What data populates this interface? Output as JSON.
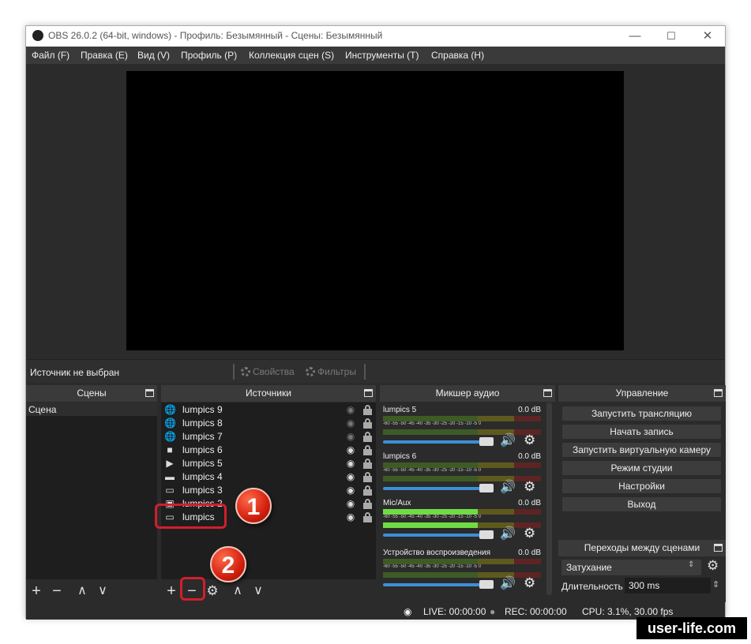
{
  "window": {
    "title": "OBS 26.0.2 (64-bit, windows) - Профиль: Безымянный - Сцены: Безымянный",
    "minimize": "—",
    "maximize": "☐",
    "close": "✕"
  },
  "menu": [
    "Файл (F)",
    "Правка (E)",
    "Вид (V)",
    "Профиль (P)",
    "Коллекция сцен (S)",
    "Инструменты (T)",
    "Справка (H)"
  ],
  "source_bar": {
    "label": "Источник не выбран",
    "properties": "Свойства",
    "filters": "Фильтры"
  },
  "scenes": {
    "title": "Сцены",
    "items": [
      "Сцена"
    ]
  },
  "sources": {
    "title": "Источники",
    "items": [
      {
        "name": "lumpics 9",
        "icon": "globe-icon",
        "visible": false
      },
      {
        "name": "lumpics 8",
        "icon": "globe-icon",
        "visible": false
      },
      {
        "name": "lumpics 7",
        "icon": "globe-icon",
        "visible": false
      },
      {
        "name": "lumpics 6",
        "icon": "camera-icon",
        "visible": true
      },
      {
        "name": "lumpics 5",
        "icon": "play-icon",
        "visible": true
      },
      {
        "name": "lumpics 4",
        "icon": "gamepad-icon",
        "visible": true
      },
      {
        "name": "lumpics 3",
        "icon": "window-icon",
        "visible": true
      },
      {
        "name": "lumpics 2",
        "icon": "display-icon",
        "visible": true
      },
      {
        "name": "lumpics",
        "icon": "window-icon",
        "visible": true
      }
    ]
  },
  "mixer": {
    "title": "Микшер аудио",
    "ticks": "-60 -55 -50 -45 -40 -35 -30 -25 -20 -15 -10 -5 0",
    "channels": [
      {
        "name": "lumpics 5",
        "db": "0.0 dB",
        "active": false
      },
      {
        "name": "lumpics 6",
        "db": "0.0 dB",
        "active": false
      },
      {
        "name": "Mic/Aux",
        "db": "0.0 dB",
        "active": true
      },
      {
        "name": "Устройство воспроизведения",
        "db": "0.0 dB",
        "active": false
      }
    ]
  },
  "controls": {
    "title": "Управление",
    "buttons": [
      "Запустить трансляцию",
      "Начать запись",
      "Запустить виртуальную камеру",
      "Режим студии",
      "Настройки",
      "Выход"
    ]
  },
  "transitions": {
    "title": "Переходы между сценами",
    "selected": "Затухание",
    "duration_label": "Длительность",
    "duration_value": "300 ms"
  },
  "status": {
    "live": "LIVE: 00:00:00",
    "rec": "REC: 00:00:00",
    "cpu": "CPU: 3.1%, 30.00 fps"
  },
  "annotations": {
    "badge1": "1",
    "badge2": "2"
  },
  "watermark": "user-life.com",
  "colors": {
    "accent_red": "#d21e2b",
    "fader_blue": "#3c8fd6",
    "meter_green": "#6fdc45"
  }
}
